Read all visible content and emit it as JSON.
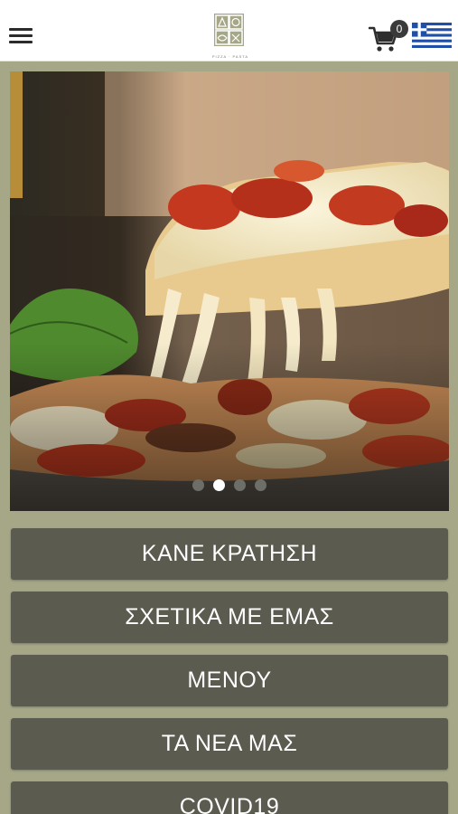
{
  "header": {
    "menu_icon": "hamburger-menu-icon",
    "logo_caption": "PIZZA · PASTA",
    "cart_icon": "shopping-cart-icon",
    "cart_count": "0",
    "language_flag": "greek-flag-icon"
  },
  "carousel": {
    "image": "pizza-slice-cheese-pull-photo",
    "slide_count": 4,
    "active_index": 1
  },
  "nav": {
    "reservation": "ΚΑΝΕ ΚΡΑΤΗΣΗ",
    "about": "ΣΧΕΤΙΚΑ ΜΕ ΕΜΑΣ",
    "menu": "ΜΕΝΟΥ",
    "news": "ΤΑ ΝΕΑ ΜΑΣ",
    "covid": "COVID19"
  },
  "colors": {
    "page_background": "#a5a787",
    "button_background": "#5b5b4f",
    "header_background": "#ffffff",
    "greek_flag_blue": "#1f4fa8"
  }
}
